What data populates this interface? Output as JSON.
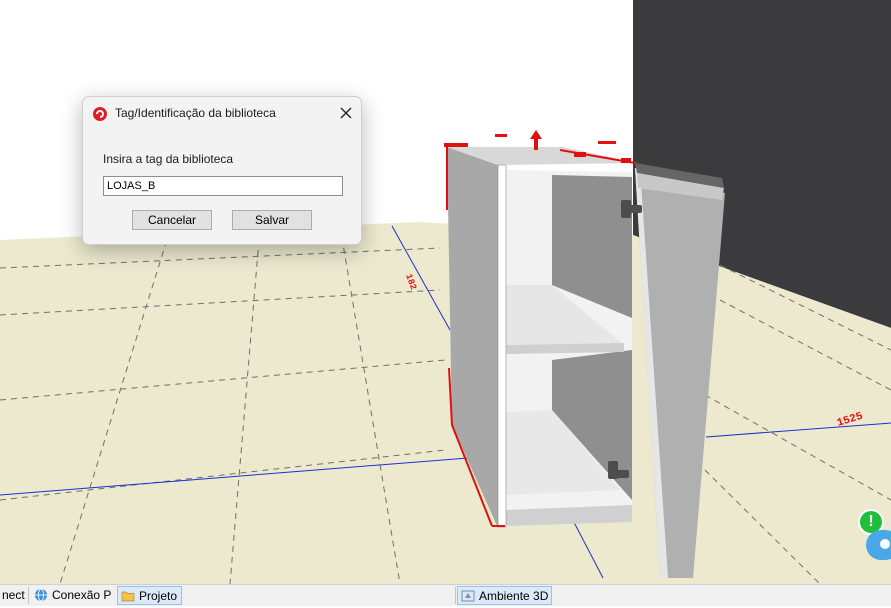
{
  "dialog": {
    "title": "Tag/Identificação da biblioteca",
    "prompt": "Insira a tag da biblioteca",
    "input_value": "LOJAS_B",
    "cancel_label": "Cancelar",
    "save_label": "Salvar",
    "close_icon": "close-icon",
    "app_icon": "app-logo-icon"
  },
  "viewport": {
    "dimension_labels": [
      "1525",
      "182"
    ],
    "colors": {
      "floor": "#ece9cf",
      "wall_dark": "#3b3b3d",
      "wall_light": "#ffffff",
      "cabinet_side": "#a8a8a8",
      "cabinet_interior": "#f2f2f2",
      "door": "#b0b0b0",
      "selection_red": "#e01010",
      "guide_blue": "#1f2fd0"
    }
  },
  "status": {
    "alert_icon": "alert-icon",
    "alert_symbol": "!",
    "chat_icon": "chat-icon"
  },
  "taskbar": {
    "items": [
      {
        "label": "nect",
        "icon": "app-icon"
      },
      {
        "label": "Conexão P",
        "icon": "globe-icon"
      },
      {
        "label": "Projeto",
        "icon": "folder-icon",
        "active": true
      },
      {
        "label": "Ambiente 3D",
        "icon": "view3d-icon",
        "active": true
      }
    ]
  }
}
